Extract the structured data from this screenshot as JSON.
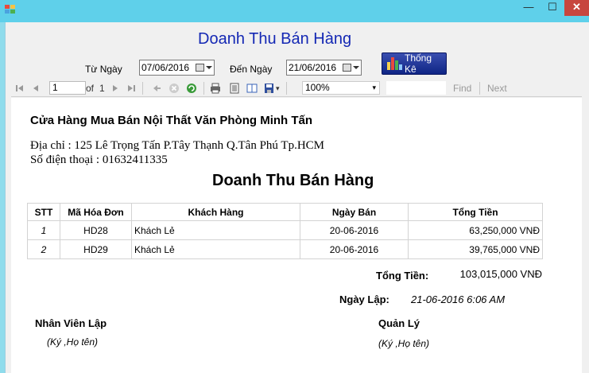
{
  "window": {
    "minimize_glyph": "—",
    "maximize_glyph": "☐",
    "close_glyph": "✕",
    "close_color": "#c7463e"
  },
  "form": {
    "title": "Doanh Thu Bán Hàng",
    "from_label": "Từ Ngày",
    "from_value": "07/06/2016",
    "to_label": "Đến Ngày",
    "to_value": "21/06/2016",
    "stat_button": "Thống Kê"
  },
  "toolbar": {
    "page_current": "1",
    "page_of": "of",
    "page_total": "1",
    "zoom": "100%",
    "find": "Find",
    "next": "Next"
  },
  "report": {
    "shop_name": "Cửa Hàng Mua Bán Nội Thất Văn Phòng Minh Tấn",
    "address": "Địa chỉ : 125 Lê Trọng Tấn P.Tây Thạnh Q.Tân Phú Tp.HCM",
    "phone": "Số điện thoại : 01632411335",
    "title": "Doanh Thu Bán Hàng",
    "columns": {
      "stt": "STT",
      "ma": "Mã Hóa Đơn",
      "kh": "Khách Hàng",
      "ngay": "Ngày Bán",
      "tien": "Tổng Tiền"
    },
    "rows": [
      {
        "stt": "1",
        "ma": "HD28",
        "kh": "Khách Lẻ",
        "ngay": "20-06-2016",
        "tien": "63,250,000 VNĐ"
      },
      {
        "stt": "2",
        "ma": "HD29",
        "kh": "Khách Lẻ",
        "ngay": "20-06-2016",
        "tien": "39,765,000 VNĐ"
      }
    ],
    "total_label": "Tổng Tiền:",
    "total_value": "103,015,000 VNĐ",
    "date_label": "Ngày Lập:",
    "date_value": "21-06-2016  6:06 AM",
    "sig_left": "Nhân Viên Lập",
    "sig_left_note": "(Ký ,Họ tên)",
    "sig_right": "Quản Lý",
    "sig_right_note": "(Ký ,Họ tên)"
  }
}
